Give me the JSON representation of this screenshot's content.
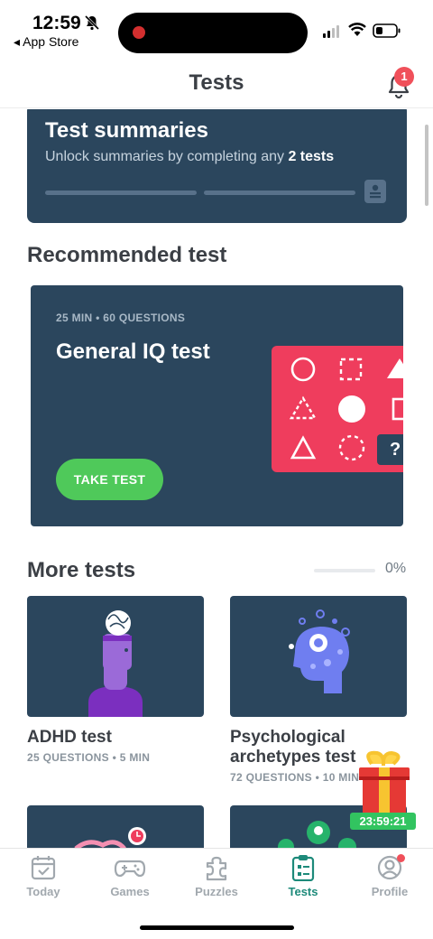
{
  "status_bar": {
    "time": "12:59",
    "back_app": "◂ App Store"
  },
  "header": {
    "title": "Tests",
    "notification_count": "1"
  },
  "summary": {
    "title": "Test summaries",
    "subtitle_prefix": "Unlock summaries by completing any ",
    "subtitle_bold": "2 tests",
    "progress": 0
  },
  "recommended": {
    "section_title": "Recommended test",
    "meta": "25 MIN • 60 QUESTIONS",
    "title": "General IQ test",
    "button_label": "TAKE TEST",
    "puzzle_mark": "?"
  },
  "more_tests": {
    "section_title": "More tests",
    "progress_pct": "0%",
    "tests": [
      {
        "title": "ADHD test",
        "meta": "25 QUESTIONS • 5 MIN"
      },
      {
        "title_line1": "Psychological",
        "title_line2": "archetypes test",
        "meta": "72 QUESTIONS • 10 MIN"
      }
    ]
  },
  "gift": {
    "timer": "23:59:21"
  },
  "tabbar": {
    "tabs": [
      {
        "label": "Today",
        "icon": "calendar-icon"
      },
      {
        "label": "Games",
        "icon": "gamepad-icon"
      },
      {
        "label": "Puzzles",
        "icon": "puzzle-icon"
      },
      {
        "label": "Tests",
        "icon": "clipboard-icon",
        "active": true
      },
      {
        "label": "Profile",
        "icon": "profile-icon"
      }
    ]
  },
  "colors": {
    "card_navy": "#2b465d",
    "accent_green": "#4fc95a",
    "panel_pink": "#ef3d5d",
    "active_teal": "#1d8a7a",
    "badge_red": "#f0505a"
  }
}
